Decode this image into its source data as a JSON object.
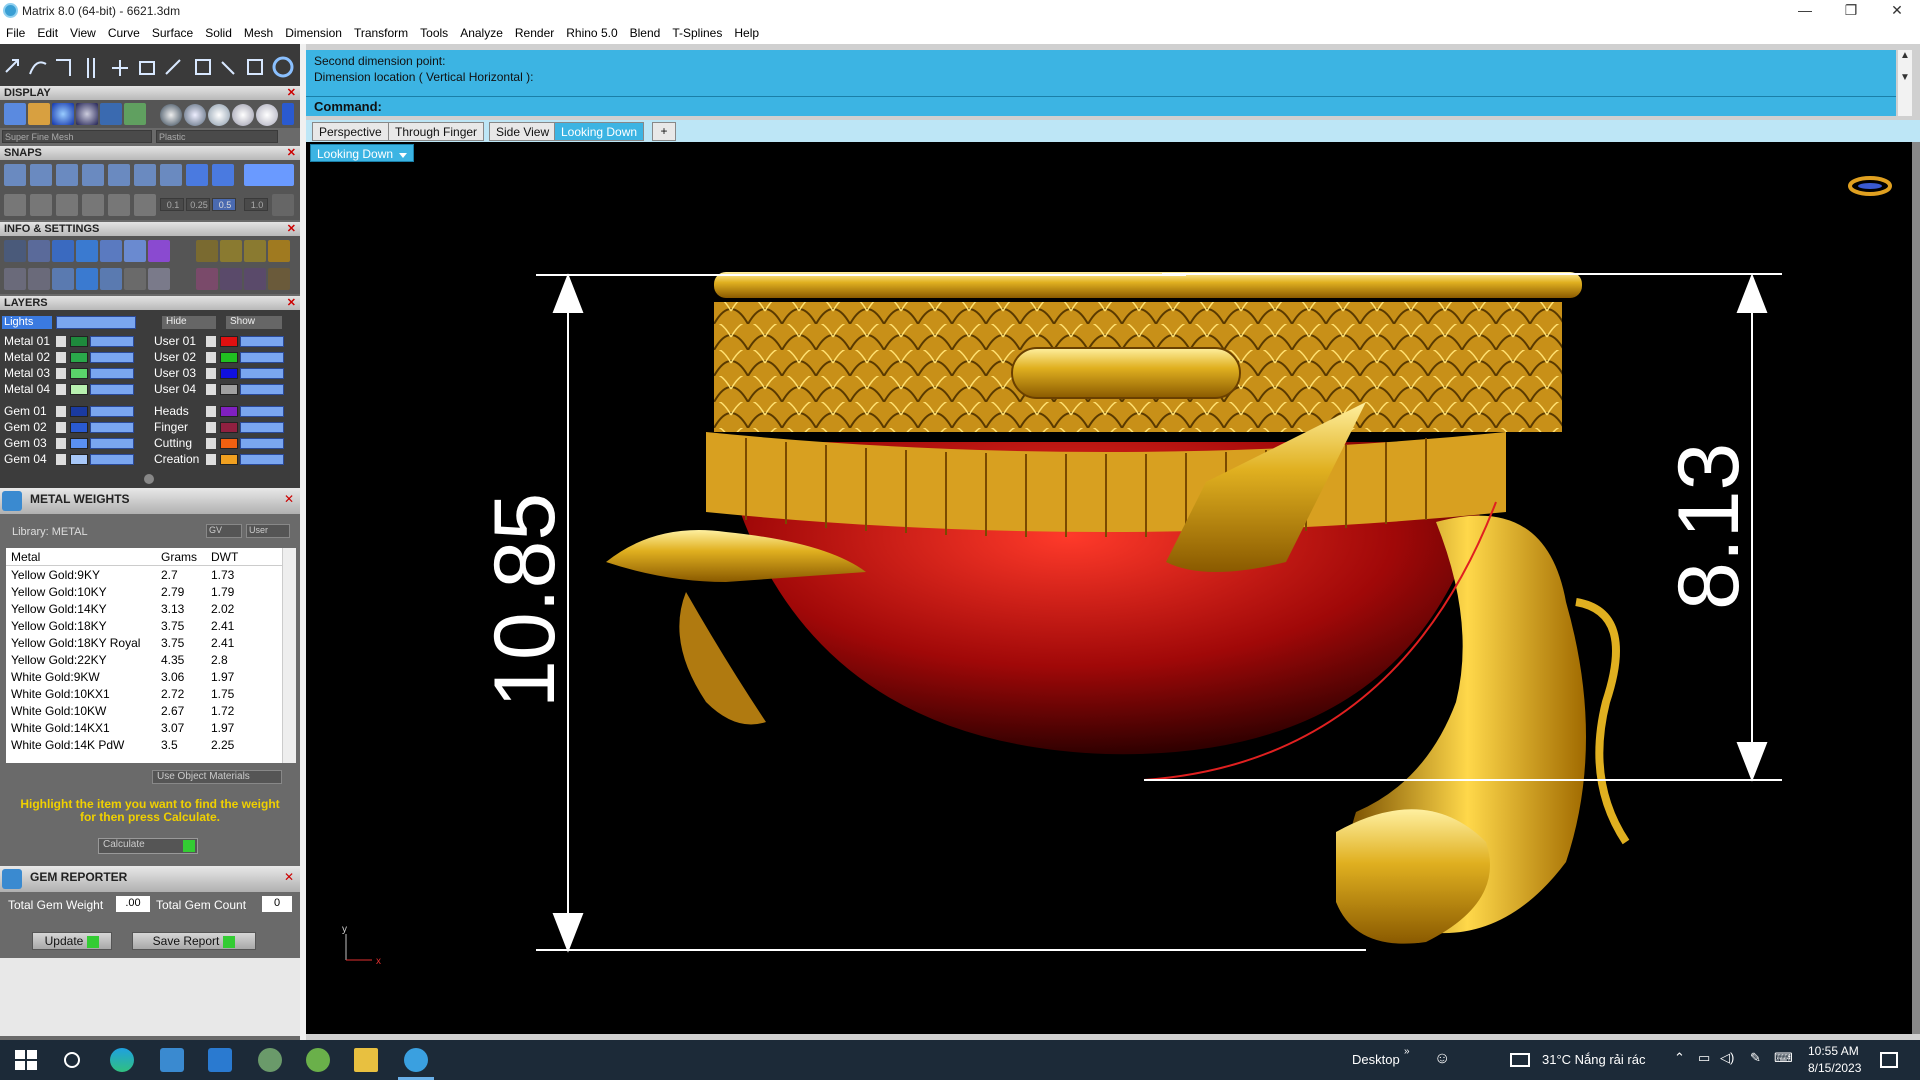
{
  "window": {
    "title": "Matrix 8.0 (64-bit) - 6621.3dm",
    "minimize": "—",
    "restore": "❐",
    "close": "✕"
  },
  "menu": [
    "File",
    "Edit",
    "View",
    "Curve",
    "Surface",
    "Solid",
    "Mesh",
    "Dimension",
    "Transform",
    "Tools",
    "Analyze",
    "Render",
    "Rhino 5.0",
    "Blend",
    "T-Splines",
    "Help"
  ],
  "panels": {
    "display": {
      "title": "DISPLAY",
      "mesh_select": "Super Fine Mesh",
      "material_select": "Plastic"
    },
    "snaps": {
      "title": "SNAPS",
      "values": [
        "0.1",
        "0.25",
        "0.5",
        "1.0"
      ]
    },
    "info": {
      "title": "INFO & SETTINGS"
    },
    "layers": {
      "title": "LAYERS",
      "lights": "Lights",
      "hide": "Hide",
      "show": "Show",
      "left": [
        {
          "name": "Metal 01",
          "color": "#1e8a3c"
        },
        {
          "name": "Metal 02",
          "color": "#2aa84a"
        },
        {
          "name": "Metal 03",
          "color": "#5ad46a"
        },
        {
          "name": "Metal 04",
          "color": "#b8f0b0"
        },
        {
          "name": "Gem 01",
          "color": "#1a3aa0"
        },
        {
          "name": "Gem 02",
          "color": "#2a5ad0"
        },
        {
          "name": "Gem 03",
          "color": "#5a90f0"
        },
        {
          "name": "Gem 04",
          "color": "#a8c8f8"
        }
      ],
      "right": [
        {
          "name": "User 01",
          "color": "#e01010"
        },
        {
          "name": "User 02",
          "color": "#20c020"
        },
        {
          "name": "User 03",
          "color": "#1010e0"
        },
        {
          "name": "User 04",
          "color": "#a0a0a0"
        },
        {
          "name": "Heads",
          "color": "#8020c0"
        },
        {
          "name": "Finger",
          "color": "#902040"
        },
        {
          "name": "Cutting",
          "color": "#f06010"
        },
        {
          "name": "Creation",
          "color": "#f0a020"
        }
      ]
    },
    "metal_weights": {
      "title": "METAL WEIGHTS",
      "library": "Library: METAL",
      "gv_btn": "GV",
      "user_btn": "User",
      "columns": [
        "Metal",
        "Grams",
        "DWT"
      ],
      "rows": [
        [
          "Yellow Gold:9KY",
          "2.7",
          "1.73"
        ],
        [
          "Yellow Gold:10KY",
          "2.79",
          "1.79"
        ],
        [
          "Yellow Gold:14KY",
          "3.13",
          "2.02"
        ],
        [
          "Yellow Gold:18KY",
          "3.75",
          "2.41"
        ],
        [
          "Yellow Gold:18KY Royal",
          "3.75",
          "2.41"
        ],
        [
          "Yellow Gold:22KY",
          "4.35",
          "2.8"
        ],
        [
          "White Gold:9KW",
          "3.06",
          "1.97"
        ],
        [
          "White Gold:10KX1",
          "2.72",
          "1.75"
        ],
        [
          "White Gold:10KW",
          "2.67",
          "1.72"
        ],
        [
          "White Gold:14KX1",
          "3.07",
          "1.97"
        ],
        [
          "White Gold:14K PdW",
          "3.5",
          "2.25"
        ]
      ],
      "use_object_materials": "Use Object Materials",
      "hint": "Highlight the item you want to find the weight for then press Calculate.",
      "calculate": "Calculate"
    },
    "gem_reporter": {
      "title": "GEM REPORTER",
      "total_weight_label": "Total Gem Weight",
      "total_weight_value": ".00",
      "total_count_label": "Total Gem Count",
      "total_count_value": "0",
      "update": "Update",
      "save_report": "Save Report"
    }
  },
  "command": {
    "line1": "Second dimension point:",
    "line2": "Dimension location ( Vertical  Horizontal ):",
    "prompt": "Command:"
  },
  "tabs": [
    "Perspective",
    "Through Finger",
    "Side View",
    "Looking Down",
    "+"
  ],
  "active_tab": "Looking Down",
  "viewport_label": "Looking Down",
  "dimensions": {
    "left": "10.85",
    "right": "8.13"
  },
  "axis": {
    "y": "y",
    "x": "x"
  },
  "taskbar": {
    "desktop": "Desktop",
    "weather": "31°C  Nắng rải rác",
    "time": "10:55 AM",
    "date": "8/15/2023"
  },
  "colors": {
    "accent": "#3cb4e3",
    "gold": "#e0b020",
    "gem": "#c01010"
  }
}
